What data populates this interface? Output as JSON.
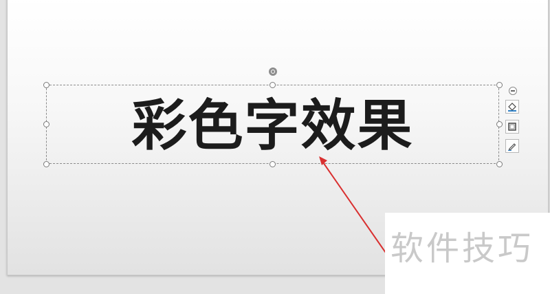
{
  "slide": {
    "textbox_text": "彩色字效果"
  },
  "tools": {
    "collapse": "collapse-panel",
    "items": [
      {
        "icon": "fill-bucket-icon"
      },
      {
        "icon": "border-frame-icon"
      },
      {
        "icon": "pen-icon"
      }
    ]
  },
  "annotation": {
    "arrow_color": "#d93030"
  },
  "watermark": {
    "text": "软件技巧"
  }
}
